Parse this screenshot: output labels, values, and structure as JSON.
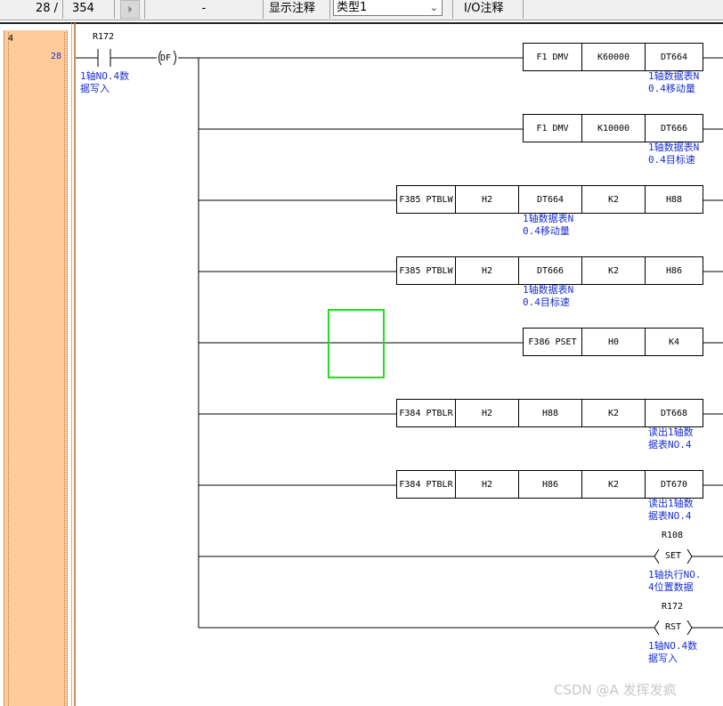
{
  "toolbar": {
    "step_current": "28 /",
    "step_total": "354",
    "dash": "-",
    "show_comment_label": "显示注释",
    "comment_type_value": "类型1",
    "io_comment_label": "I/O注释"
  },
  "rung": {
    "number": "4",
    "step": "28"
  },
  "contact": {
    "address": "R172",
    "comment": [
      "1轴NO.4数",
      "据写入"
    ]
  },
  "df_label": "DF",
  "instructions": [
    {
      "cells": [
        "F1 DMV",
        "K60000",
        "DT664"
      ],
      "comment": [
        "1轴数据表N",
        "0.4移动量"
      ]
    },
    {
      "cells": [
        "F1 DMV",
        "K10000",
        "DT666"
      ],
      "comment": [
        "1轴数据表N",
        "0.4目标速"
      ]
    },
    {
      "cells": [
        "F385 PTBLW",
        "H2",
        "DT664",
        "K2",
        "H88"
      ],
      "comment": [
        "1轴数据表N",
        "0.4移动量"
      ]
    },
    {
      "cells": [
        "F385 PTBLW",
        "H2",
        "DT666",
        "K2",
        "H86"
      ],
      "comment": [
        "1轴数据表N",
        "0.4目标速"
      ]
    },
    {
      "cells": [
        "F386 PSET",
        "H0",
        "K4"
      ],
      "comment": []
    },
    {
      "cells": [
        "F384 PTBLR",
        "H2",
        "H88",
        "K2",
        "DT668"
      ],
      "comment": [
        "读出1轴数",
        "据表NO.4"
      ]
    },
    {
      "cells": [
        "F384 PTBLR",
        "H2",
        "H86",
        "K2",
        "DT670"
      ],
      "comment": [
        "读出1轴数",
        "据表NO.4"
      ]
    }
  ],
  "coils": [
    {
      "address": "R108",
      "type": "SET",
      "comment": [
        "1轴执行NO.",
        "4位置数据"
      ]
    },
    {
      "address": "R172",
      "type": "RST",
      "comment": [
        "1轴NO.4数",
        "据写入"
      ]
    }
  ],
  "watermark": "CSDN @A  发挥发疯",
  "colors": {
    "rownum_bg": "#ffcc99",
    "comment_text": "#1a2fd0",
    "cursor": "#22dd22"
  }
}
